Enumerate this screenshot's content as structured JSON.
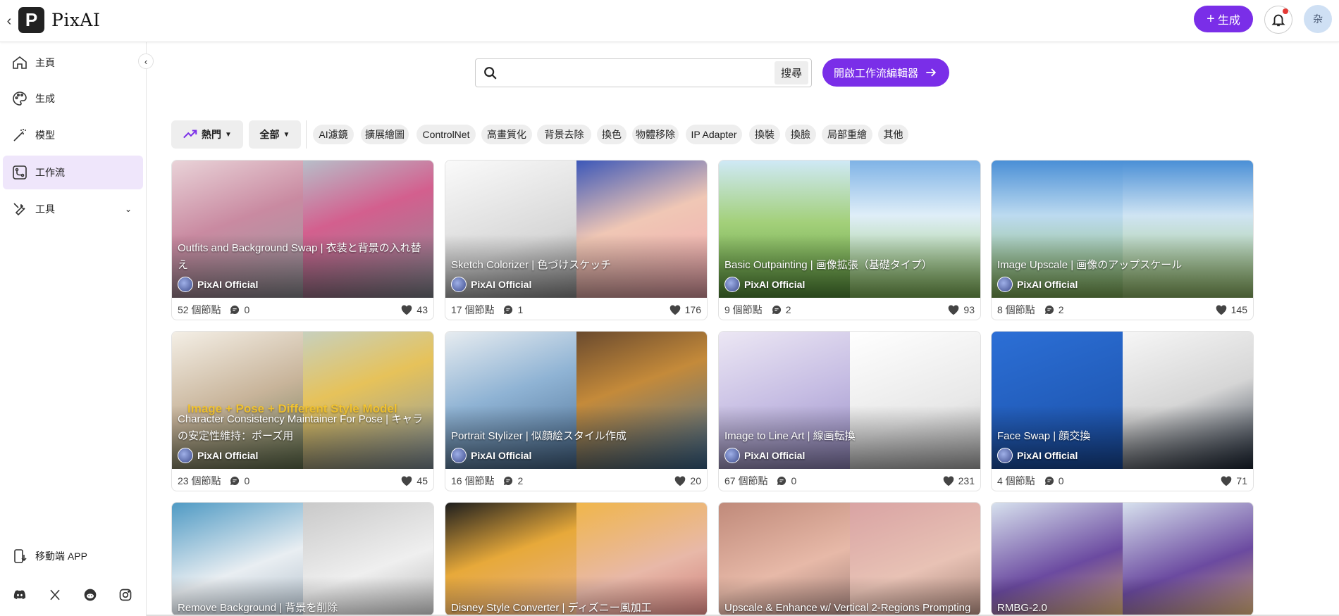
{
  "app": {
    "name": "PixAI",
    "logo_letter": "P"
  },
  "header": {
    "generate_label": "生成",
    "avatar_text": "杂"
  },
  "sidebar": {
    "items": [
      {
        "label": "主頁",
        "icon": "home-icon"
      },
      {
        "label": "生成",
        "icon": "palette-icon"
      },
      {
        "label": "模型",
        "icon": "magic-wand-icon"
      },
      {
        "label": "工作流",
        "icon": "workflow-icon",
        "active": true
      },
      {
        "label": "工具",
        "icon": "tools-icon",
        "expandable": true
      }
    ],
    "mobile_app_label": "移動端 APP",
    "socials": [
      "discord-icon",
      "x-icon",
      "reddit-icon",
      "instagram-icon"
    ]
  },
  "search": {
    "placeholder": "",
    "value": "",
    "button_label": "搜尋"
  },
  "workflow_editor_label": "開啟工作流編輯器",
  "filters": {
    "sort_label": "熱門",
    "scope_label": "全部",
    "chips": [
      "AI濾鏡",
      "擴展繪圖",
      "ControlNet",
      "高畫質化",
      "背景去除",
      "換色",
      "物體移除",
      "IP Adapter",
      "換裝",
      "換臉",
      "局部重繪",
      "其他"
    ]
  },
  "cards": [
    {
      "title": "Outfits and Background Swap | 衣装と背景の入れ替え",
      "author": "PixAI Official",
      "nodes": "52 個節點",
      "comments": "0",
      "likes": "43"
    },
    {
      "title": "Sketch Colorizer | 色づけスケッチ",
      "author": "PixAI Official",
      "nodes": "17 個節點",
      "comments": "1",
      "likes": "176"
    },
    {
      "title": "Basic Outpainting | 画像拡張（基礎タイプ）",
      "author": "PixAI Official",
      "nodes": "9 個節點",
      "comments": "2",
      "likes": "93"
    },
    {
      "title": "Image Upscale | 画像のアップスケール",
      "author": "PixAI Official",
      "nodes": "8 個節點",
      "comments": "2",
      "likes": "145"
    },
    {
      "title": "Character Consistency Maintainer For Pose | キャラの安定性維持：ポーズ用",
      "author": "PixAI Official",
      "nodes": "23 個節點",
      "comments": "0",
      "likes": "45",
      "overlay_text": "Image + Pose + Different Style Model"
    },
    {
      "title": "Portrait Stylizer | 似顔絵スタイル作成",
      "author": "PixAI Official",
      "nodes": "16 個節點",
      "comments": "2",
      "likes": "20"
    },
    {
      "title": "Image to Line Art | 線画転換",
      "author": "PixAI Official",
      "nodes": "67 個節點",
      "comments": "0",
      "likes": "231"
    },
    {
      "title": "Face Swap | 顔交換",
      "author": "PixAI Official",
      "nodes": "4 個節點",
      "comments": "0",
      "likes": "71"
    },
    {
      "title": "Remove Background | 背景を削除",
      "author": "",
      "nodes": "",
      "comments": "",
      "likes": ""
    },
    {
      "title": "Disney Style Converter | ディズニー風加工",
      "author": "",
      "nodes": "",
      "comments": "",
      "likes": ""
    },
    {
      "title": "Upscale & Enhance w/ Vertical 2-Regions Prompting",
      "author": "",
      "nodes": "",
      "comments": "",
      "likes": ""
    },
    {
      "title": "RMBG-2.0",
      "author": "",
      "nodes": "",
      "comments": "",
      "likes": ""
    }
  ],
  "colors": {
    "accent": "#7a2ee8",
    "active_bg": "#efe6fb"
  }
}
